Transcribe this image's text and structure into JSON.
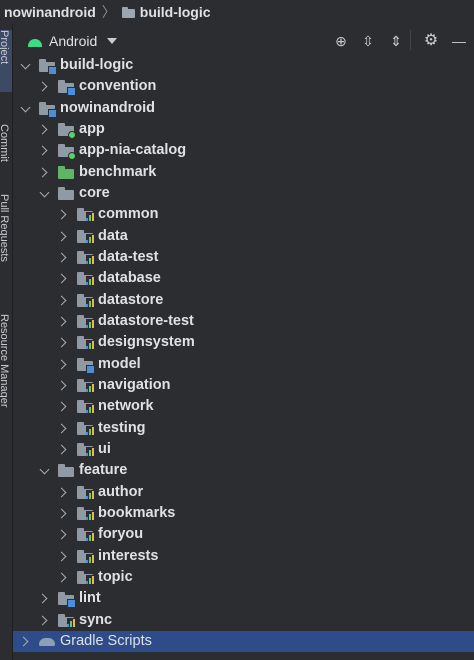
{
  "breadcrumb": {
    "root": "nowinandroid",
    "separator": "〉",
    "current": "build-logic"
  },
  "sidebar": {
    "tabs": [
      "Project",
      "Commit",
      "Pull Requests",
      "Resource Manager"
    ]
  },
  "toolbar": {
    "view_mode": "Android",
    "icons": [
      "android-icon",
      "chevron-down-icon",
      "locate-icon",
      "expand-all-icon",
      "collapse-all-icon",
      "gear-icon",
      "minimize-icon"
    ]
  },
  "tree": [
    {
      "label": "build-logic",
      "depth": 0,
      "expanded": true,
      "icon": "folder-module",
      "selected": false
    },
    {
      "label": "convention",
      "depth": 1,
      "expanded": false,
      "icon": "folder-module",
      "selected": false
    },
    {
      "label": "nowinandroid",
      "depth": 0,
      "expanded": true,
      "icon": "folder-module",
      "selected": false
    },
    {
      "label": "app",
      "depth": 1,
      "expanded": false,
      "icon": "folder-app",
      "selected": false
    },
    {
      "label": "app-nia-catalog",
      "depth": 1,
      "expanded": false,
      "icon": "folder-app",
      "selected": false
    },
    {
      "label": "benchmark",
      "depth": 1,
      "expanded": false,
      "icon": "folder-test",
      "selected": false
    },
    {
      "label": "core",
      "depth": 1,
      "expanded": true,
      "icon": "folder",
      "selected": false
    },
    {
      "label": "common",
      "depth": 2,
      "expanded": false,
      "icon": "folder-library",
      "selected": false
    },
    {
      "label": "data",
      "depth": 2,
      "expanded": false,
      "icon": "folder-library",
      "selected": false
    },
    {
      "label": "data-test",
      "depth": 2,
      "expanded": false,
      "icon": "folder-library",
      "selected": false
    },
    {
      "label": "database",
      "depth": 2,
      "expanded": false,
      "icon": "folder-library",
      "selected": false
    },
    {
      "label": "datastore",
      "depth": 2,
      "expanded": false,
      "icon": "folder-library",
      "selected": false
    },
    {
      "label": "datastore-test",
      "depth": 2,
      "expanded": false,
      "icon": "folder-library",
      "selected": false
    },
    {
      "label": "designsystem",
      "depth": 2,
      "expanded": false,
      "icon": "folder-library",
      "selected": false
    },
    {
      "label": "model",
      "depth": 2,
      "expanded": false,
      "icon": "folder-module",
      "selected": false
    },
    {
      "label": "navigation",
      "depth": 2,
      "expanded": false,
      "icon": "folder-library",
      "selected": false
    },
    {
      "label": "network",
      "depth": 2,
      "expanded": false,
      "icon": "folder-library",
      "selected": false
    },
    {
      "label": "testing",
      "depth": 2,
      "expanded": false,
      "icon": "folder-library",
      "selected": false
    },
    {
      "label": "ui",
      "depth": 2,
      "expanded": false,
      "icon": "folder-library",
      "selected": false
    },
    {
      "label": "feature",
      "depth": 1,
      "expanded": true,
      "icon": "folder",
      "selected": false
    },
    {
      "label": "author",
      "depth": 2,
      "expanded": false,
      "icon": "folder-library",
      "selected": false
    },
    {
      "label": "bookmarks",
      "depth": 2,
      "expanded": false,
      "icon": "folder-library",
      "selected": false
    },
    {
      "label": "foryou",
      "depth": 2,
      "expanded": false,
      "icon": "folder-library",
      "selected": false
    },
    {
      "label": "interests",
      "depth": 2,
      "expanded": false,
      "icon": "folder-library",
      "selected": false
    },
    {
      "label": "topic",
      "depth": 2,
      "expanded": false,
      "icon": "folder-library",
      "selected": false
    },
    {
      "label": "lint",
      "depth": 1,
      "expanded": false,
      "icon": "folder-module",
      "selected": false
    },
    {
      "label": "sync",
      "depth": 1,
      "expanded": false,
      "icon": "folder-library",
      "selected": false
    },
    {
      "label": "Gradle Scripts",
      "depth": 0,
      "expanded": false,
      "icon": "gradle-elephant",
      "selected": true
    }
  ],
  "colors": {
    "background": "#2b2d30",
    "selection": "#2e4b8a",
    "text": "#dfe1e5",
    "folder": "#8f9aa5",
    "folder_test": "#5fb563",
    "module_badge": "#4a8fd8",
    "app_badge": "#5fd068",
    "android_green": "#3ddc84"
  }
}
